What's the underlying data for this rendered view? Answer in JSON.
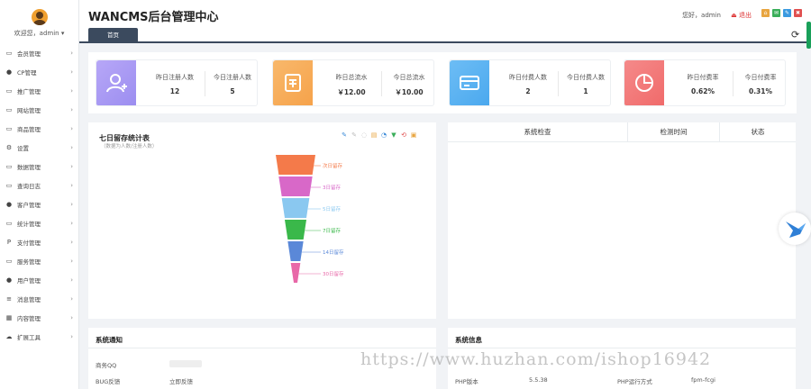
{
  "profile": {
    "name": "欢迎您，admin ▾"
  },
  "menu": [
    {
      "icon": "▭",
      "label": "会员管理"
    },
    {
      "icon": "●",
      "label": "CP管理"
    },
    {
      "icon": "▭",
      "label": "推广管理"
    },
    {
      "icon": "▭",
      "label": "网站管理"
    },
    {
      "icon": "▭",
      "label": "商品管理"
    },
    {
      "icon": "⚙",
      "label": "设置"
    },
    {
      "icon": "▭",
      "label": "数据管理"
    },
    {
      "icon": "▭",
      "label": "查询日志"
    },
    {
      "icon": "●",
      "label": "客户管理"
    },
    {
      "icon": "▭",
      "label": "统计管理"
    },
    {
      "icon": "P",
      "label": "支付管理"
    },
    {
      "icon": "▭",
      "label": "服务管理"
    },
    {
      "icon": "●",
      "label": "用户管理"
    },
    {
      "icon": "≡",
      "label": "消息管理"
    },
    {
      "icon": "▦",
      "label": "内容管理"
    },
    {
      "icon": "☁",
      "label": "扩展工具"
    }
  ],
  "header": {
    "brand": "WANCMS后台管理中心",
    "tab_home": "首页",
    "greeting": "您好，admin",
    "logout": "退出"
  },
  "stats": [
    {
      "color": "#9b8df0",
      "color2": "#b7a7f7",
      "icon": "user-add-icon",
      "a_label": "昨日注册人数",
      "a_value": "12",
      "b_label": "今日注册人数",
      "b_value": "5"
    },
    {
      "color": "#f6a24a",
      "color2": "#f8b86b",
      "icon": "receipt-icon",
      "a_label": "昨日总流水",
      "a_value": "￥12.00",
      "b_label": "今日总流水",
      "b_value": "￥10.00"
    },
    {
      "color": "#4aa8ee",
      "color2": "#6dbdf5",
      "icon": "card-icon",
      "a_label": "昨日付费人数",
      "a_value": "2",
      "b_label": "今日付费人数",
      "b_value": "1"
    },
    {
      "color": "#f06a6a",
      "color2": "#f58a8a",
      "icon": "pie-icon",
      "a_label": "昨日付费率",
      "a_value": "0.62%",
      "b_label": "今日付费率",
      "b_value": "0.31%"
    }
  ],
  "funnel": {
    "title": "七日留存统计表",
    "subtitle": "（数据为人数/注册人数）",
    "layers": [
      {
        "label": "次日留存",
        "color": "#f47a4a"
      },
      {
        "label": "3日留存",
        "color": "#d868c8"
      },
      {
        "label": "5日留存",
        "color": "#8ac8f0"
      },
      {
        "label": "7日留存",
        "color": "#3ab84a"
      },
      {
        "label": "14日留存",
        "color": "#5a88d8"
      },
      {
        "label": "30日留存",
        "color": "#e868a8"
      }
    ]
  },
  "check_table": {
    "columns": [
      "系统检查",
      "检测时间",
      "状态"
    ]
  },
  "notice": {
    "title": "系统通知",
    "rows": [
      {
        "label": "商务QQ",
        "value": ""
      },
      {
        "label": "BUG反馈",
        "value": "立即反馈"
      }
    ]
  },
  "info": {
    "title": "系统信息",
    "rows": [
      {
        "label": "PHP版本",
        "value": "5.5.38"
      },
      {
        "label": "PHP运行方式",
        "value": "fpm-fcgi"
      }
    ]
  },
  "watermark": "https://www.huzhan.com/ishop16942"
}
